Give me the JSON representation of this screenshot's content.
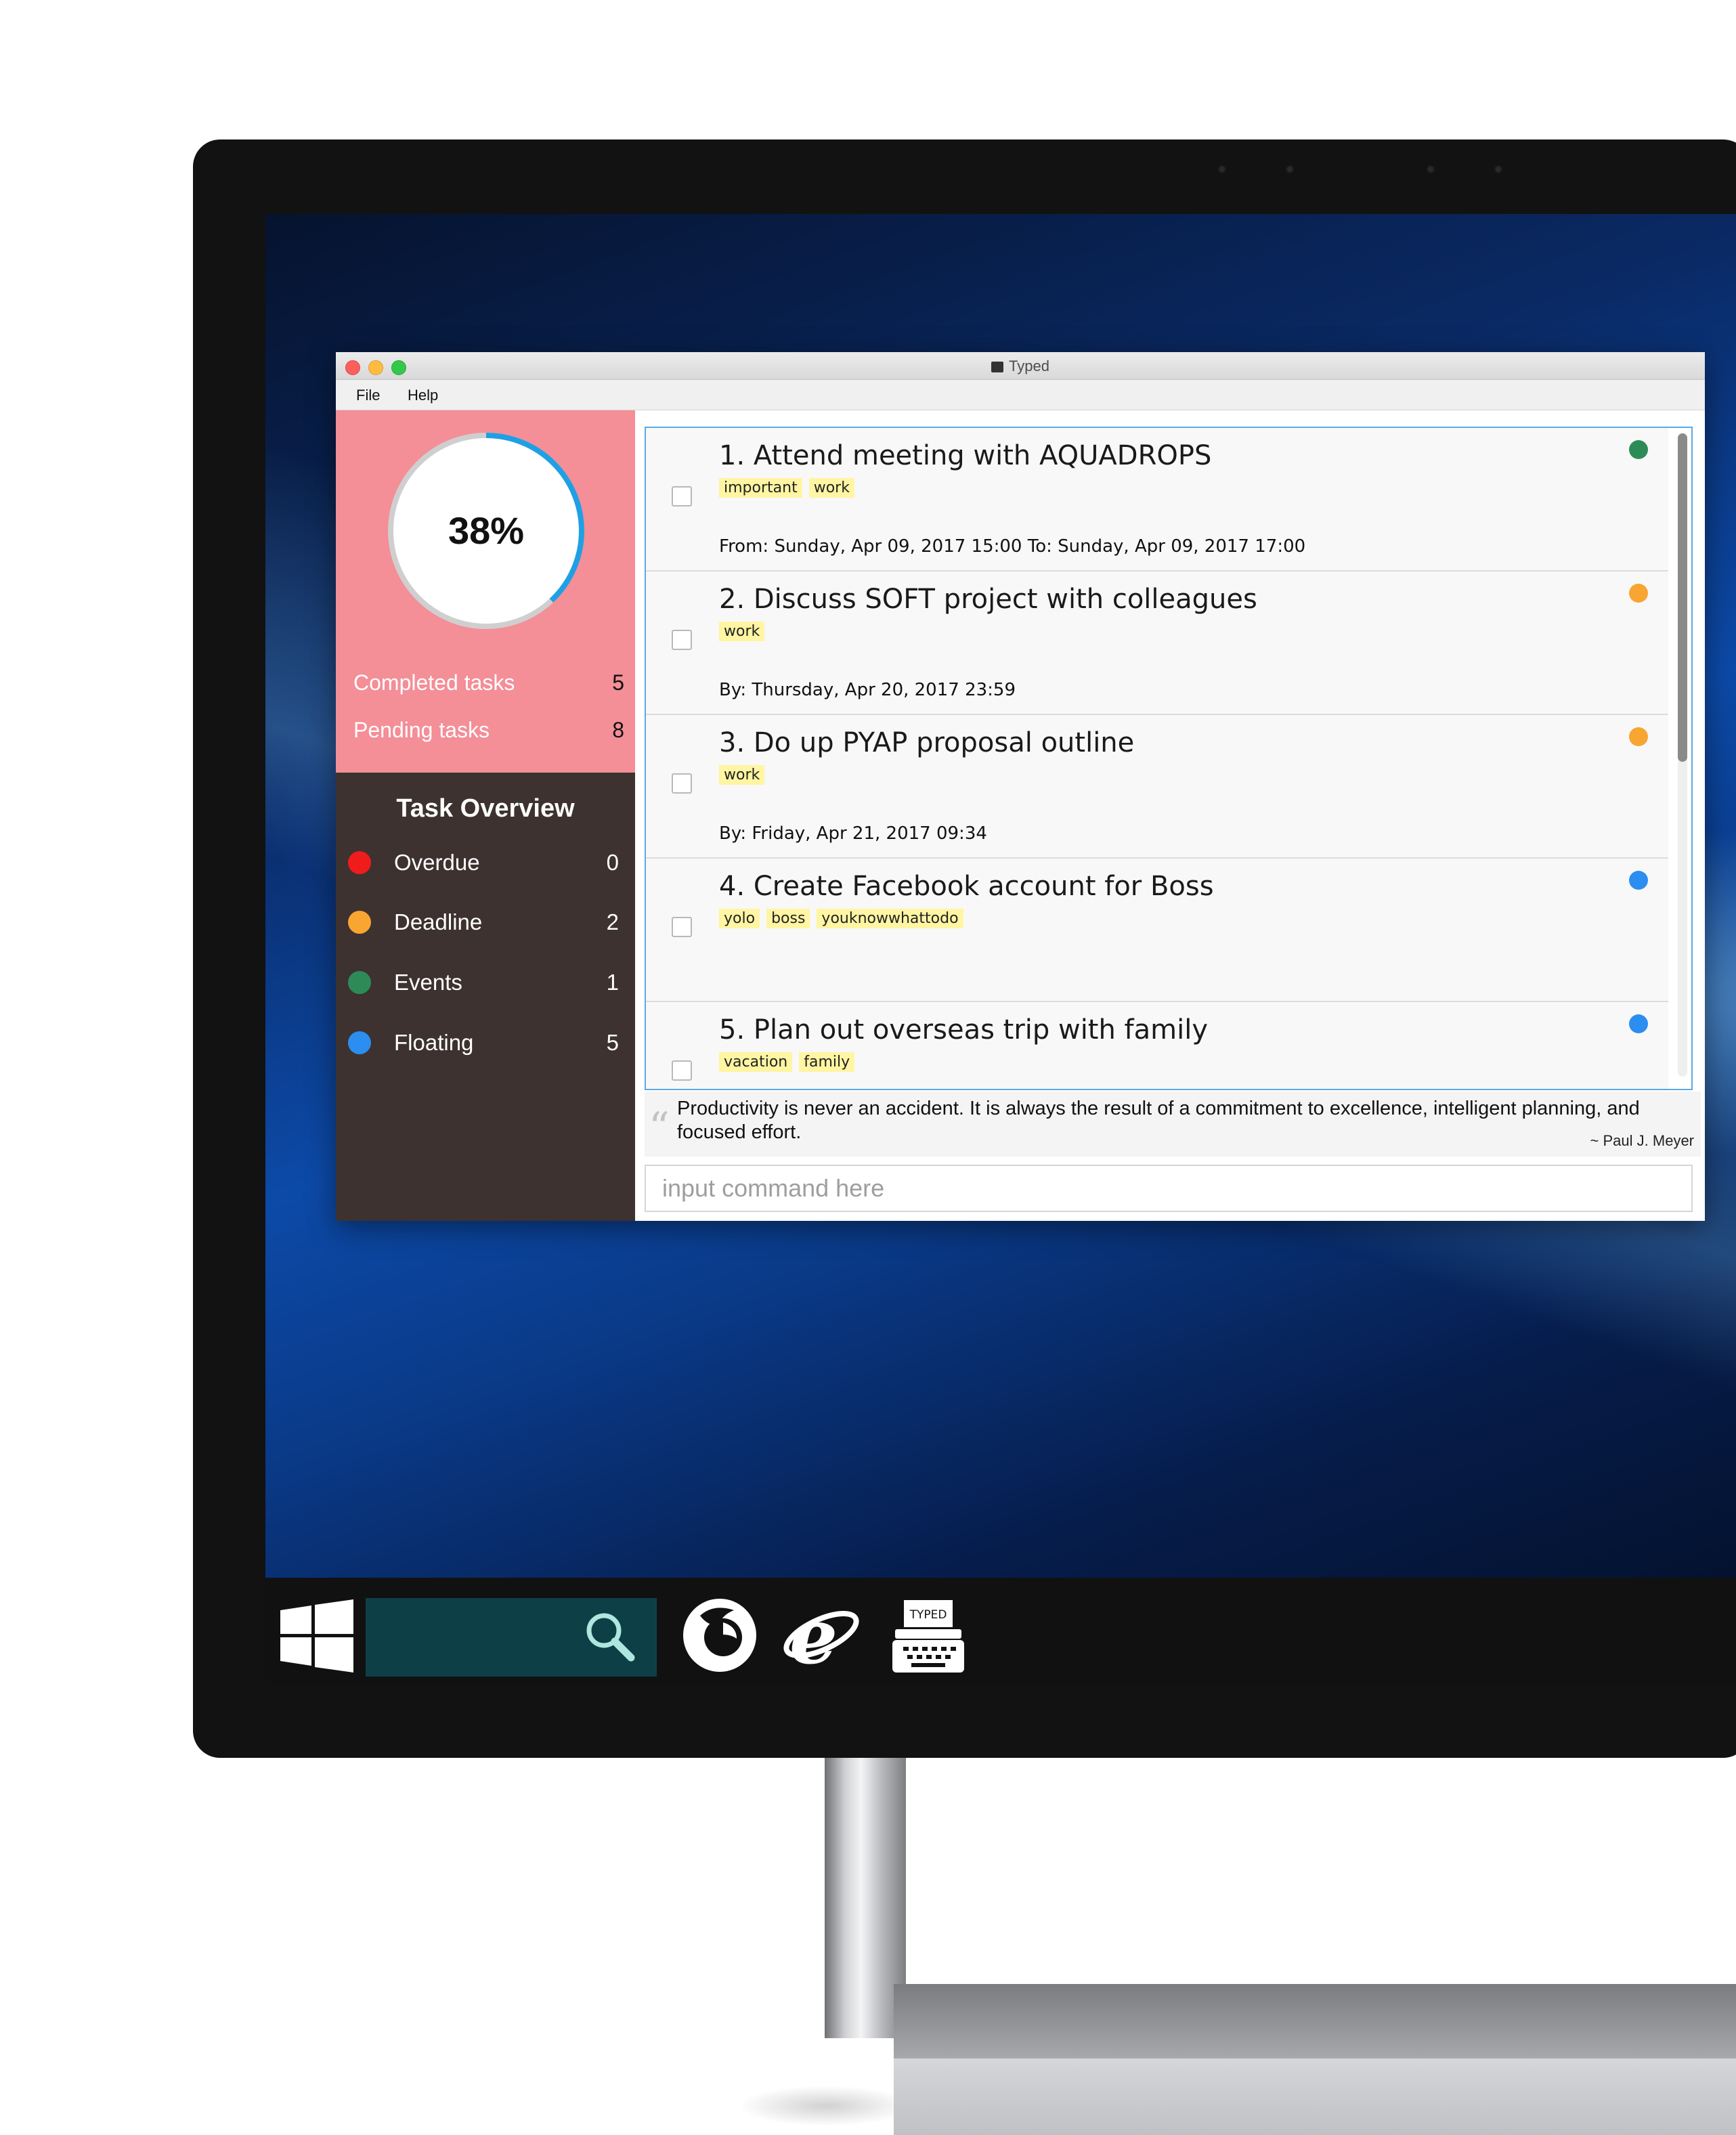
{
  "window": {
    "title": "Typed"
  },
  "menu": {
    "items": [
      "File",
      "Help"
    ]
  },
  "progress": {
    "percent_label": "38%",
    "fraction": 0.38
  },
  "stats": [
    {
      "label": "Completed tasks",
      "value": "5"
    },
    {
      "label": "Pending tasks",
      "value": "8"
    }
  ],
  "overview": {
    "title": "Task Overview",
    "rows": [
      {
        "label": "Overdue",
        "value": "0",
        "color": "#f01b1b"
      },
      {
        "label": "Deadline",
        "value": "2",
        "color": "#f8a532"
      },
      {
        "label": "Events",
        "value": "1",
        "color": "#2e8b57"
      },
      {
        "label": "Floating",
        "value": "5",
        "color": "#2b8ef0"
      }
    ]
  },
  "tasks": [
    {
      "title": "1. Attend meeting with AQUADROPS",
      "tags": [
        "important",
        "work"
      ],
      "date": "From: Sunday, Apr 09, 2017 15:00 To: Sunday, Apr 09, 2017 17:00",
      "dot_color": "#2e8b57"
    },
    {
      "title": "2. Discuss SOFT project with colleagues",
      "tags": [
        "work"
      ],
      "date": "By: Thursday, Apr 20, 2017 23:59",
      "dot_color": "#f8a532"
    },
    {
      "title": "3. Do up PYAP proposal outline",
      "tags": [
        "work"
      ],
      "date": "By: Friday, Apr 21, 2017 09:34",
      "dot_color": "#f8a532"
    },
    {
      "title": "4. Create Facebook account for Boss",
      "tags": [
        "yolo",
        "boss",
        "youknowwhattodo"
      ],
      "date": "",
      "dot_color": "#2b8ef0"
    },
    {
      "title": "5. Plan out overseas trip with family",
      "tags": [
        "vacation",
        "family"
      ],
      "date": "",
      "dot_color": "#2b8ef0"
    }
  ],
  "quote": {
    "text": "Productivity is never an accident. It is always the result of a commitment to excellence, intelligent planning, and focused effort.",
    "author": "~ Paul J. Meyer"
  },
  "command": {
    "placeholder": "input command here",
    "value": ""
  },
  "taskbar": {
    "items": [
      "windows-start-icon",
      "search-icon",
      "firefox-icon",
      "internet-explorer-icon",
      "typed-app-icon"
    ],
    "typed_icon_text": "TYPED"
  }
}
